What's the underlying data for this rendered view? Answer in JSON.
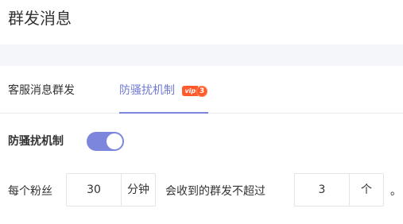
{
  "page": {
    "title": "群发消息"
  },
  "tabs": [
    {
      "label": "客服消息群发",
      "active": false
    },
    {
      "label": "防骚扰机制",
      "active": true,
      "badge": {
        "text": "vip",
        "level": "3"
      }
    }
  ],
  "anti_harass": {
    "label": "防骚扰机制",
    "enabled": true,
    "rule": {
      "prefix": "每个粉丝",
      "minutes_value": "30",
      "minutes_unit": "分钟",
      "middle": "会收到的群发不超过",
      "count_value": "3",
      "count_unit": "个",
      "suffix": "。"
    }
  },
  "colors": {
    "accent": "#7c86dd",
    "active_tab_text": "#6f7ad3",
    "vip_badge": "#ff5a2c",
    "band": "#f5f6fa",
    "border": "#e3e4ea"
  }
}
